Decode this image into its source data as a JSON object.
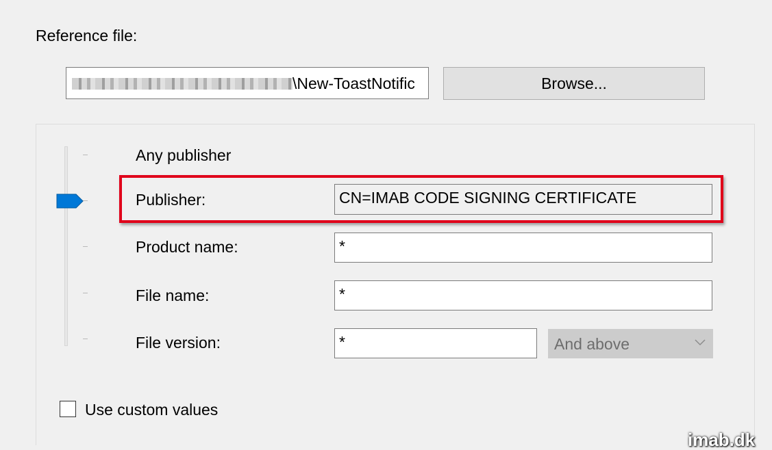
{
  "reference": {
    "label": "Reference file:",
    "path_visible": "\\New-ToastNotific",
    "browse_label": "Browse..."
  },
  "slider": {
    "selected_level": "Publisher",
    "levels": [
      "Any publisher",
      "Publisher",
      "Product name",
      "File name",
      "File version"
    ]
  },
  "rules": {
    "any_publisher_label": "Any publisher",
    "publisher_label": "Publisher:",
    "publisher_value": "CN=IMAB CODE SIGNING CERTIFICATE",
    "product_label": "Product name:",
    "product_value": "*",
    "filename_label": "File name:",
    "filename_value": "*",
    "version_label": "File version:",
    "version_value": "*",
    "version_option": "And above"
  },
  "custom_values": {
    "label": "Use custom values",
    "checked": false
  },
  "watermark": "imab.dk",
  "colors": {
    "highlight": "#e0001a",
    "slider_thumb": "#0078d7"
  },
  "icons": [
    "chevron-down-icon",
    "slider-thumb"
  ]
}
